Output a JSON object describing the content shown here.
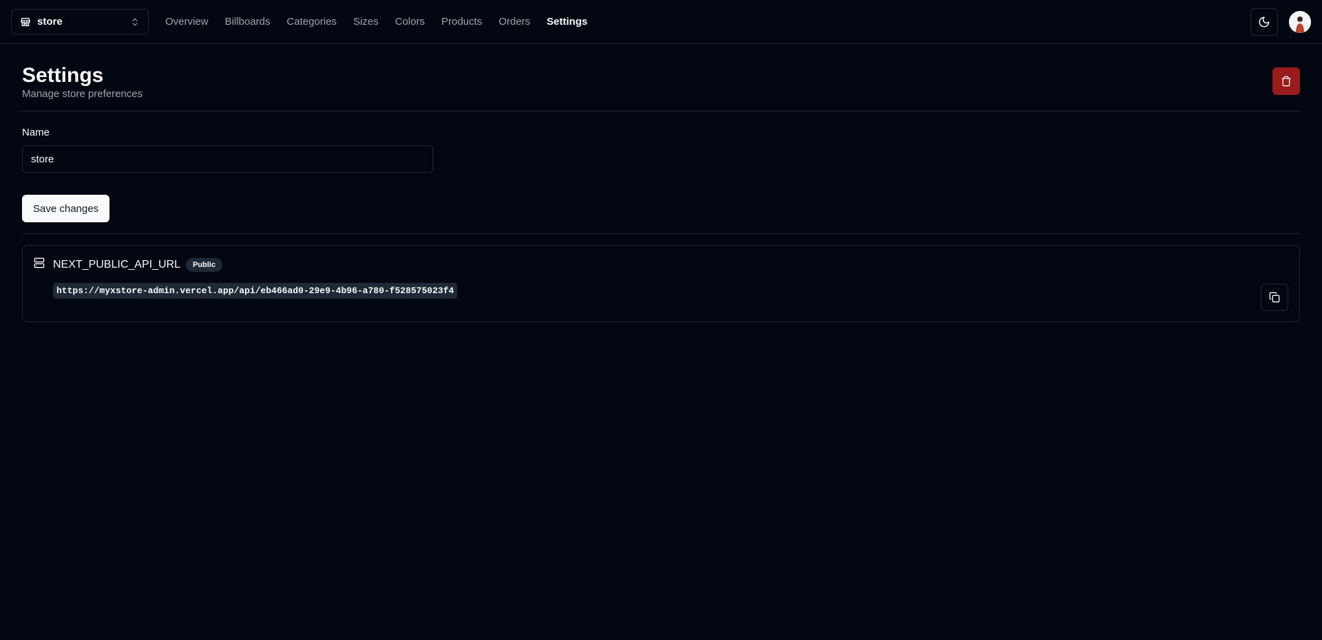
{
  "navbar": {
    "store_switcher": {
      "label": "store"
    },
    "links": [
      {
        "label": "Overview",
        "active": false
      },
      {
        "label": "Billboards",
        "active": false
      },
      {
        "label": "Categories",
        "active": false
      },
      {
        "label": "Sizes",
        "active": false
      },
      {
        "label": "Colors",
        "active": false
      },
      {
        "label": "Products",
        "active": false
      },
      {
        "label": "Orders",
        "active": false
      },
      {
        "label": "Settings",
        "active": true
      }
    ],
    "icons": {
      "store": "store-icon",
      "switch": "chevrons-up-down-icon",
      "theme": "moon-icon"
    }
  },
  "heading": {
    "title": "Settings",
    "description": "Manage store preferences"
  },
  "form": {
    "name_label": "Name",
    "name_value": "store",
    "save_label": "Save changes"
  },
  "api_alert": {
    "title": "NEXT_PUBLIC_API_URL",
    "badge": "Public",
    "url": "https://myxstore-admin.vercel.app/api/eb466ad0-29e9-4b96-a780-f528575023f4"
  },
  "colors": {
    "background": "#030712",
    "border": "#1f2937",
    "destructive": "#991b1b",
    "muted_text": "#9ca3af"
  }
}
